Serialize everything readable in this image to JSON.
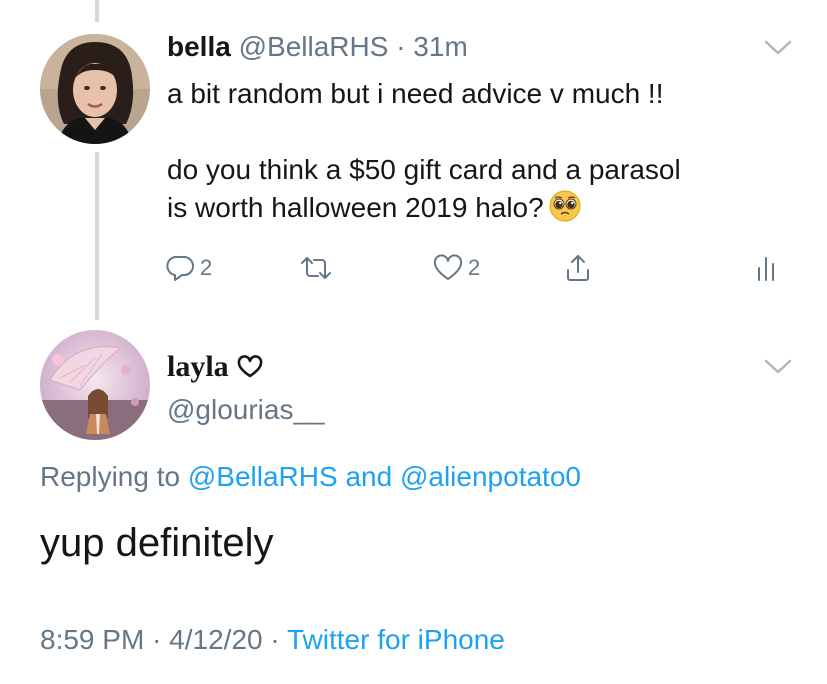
{
  "tweet": {
    "name": "bella",
    "handle": "@BellaRHS",
    "separator": "·",
    "time": "31m",
    "line1": "a bit random but i need advice v much !!",
    "line2": "do you think a $50 gift card and a parasol",
    "line3": "is worth halloween 2019 halo?",
    "emoji_icon": "pleading-face-emoji",
    "reply_count": "2",
    "like_count": "2"
  },
  "reply": {
    "name": "layla",
    "handle": "@glourias__",
    "replying_prefix": "Replying to",
    "mention1": "@BellaRHS",
    "and_word": "and",
    "mention2": "@alienpotato0",
    "text": "yup definitely",
    "time": "8:59 PM",
    "date": "4/12/20",
    "separator": "·",
    "source": "Twitter for iPhone"
  },
  "icons": [
    "chevron-down-icon",
    "reply-icon",
    "retweet-icon",
    "heart-icon",
    "share-icon",
    "analytics-icon",
    "heart-outline-icon"
  ],
  "colors": {
    "text": "#14171a",
    "muted": "#657786",
    "link": "#1da1f2",
    "thread_line": "#cfd9de"
  }
}
